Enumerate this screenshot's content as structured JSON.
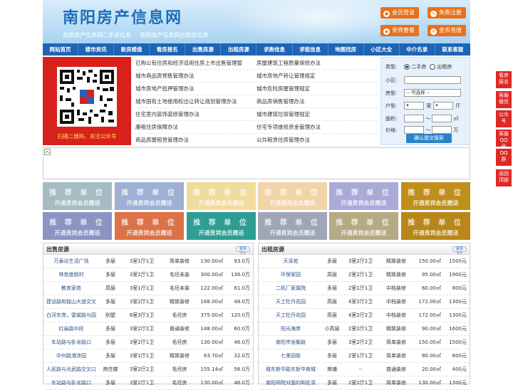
{
  "header": {
    "title": "南阳房产信息网",
    "subtitles": [
      "南阳房产信息网二手房信息",
      "南阳房产信息网出租房信息"
    ],
    "buttons": [
      {
        "label": "会员登录",
        "icon": "user-icon"
      },
      {
        "label": "免费注册",
        "icon": "edit-icon"
      },
      {
        "label": "贵宾套餐",
        "icon": "gift-icon"
      },
      {
        "label": "金币充值",
        "icon": "coin-icon"
      }
    ]
  },
  "nav": [
    "网站首页",
    "楼市资讯",
    "新房楼盘",
    "看房报名",
    "出售房源",
    "出租房源",
    "求购信息",
    "求租信息",
    "地图找房",
    "小区大全",
    "中介名录",
    "联系客服"
  ],
  "qr": {
    "caption": "扫描二维码，关注公众号"
  },
  "links": [
    [
      "已购公有住房和经济适用住房上市出售管理暂",
      "房屋建筑工程质量保修办法"
    ],
    [
      "城市商品房预售管理办法",
      "城市房地产转让管理规定"
    ],
    [
      "城市房地产抵押管理办法",
      "城市危险房屋管理规定"
    ],
    [
      "城市国有土地使用权出让转让规划管理办法",
      "商品房销售管理办法"
    ],
    [
      "住宅室内装饰装修管理办法",
      "城市建筑垃圾管理规定"
    ],
    [
      "廉租住房保障办法",
      "住宅专项维修资金管理办法"
    ],
    [
      "商品房屋租赁管理办法",
      "公共租赁住房管理办法"
    ]
  ],
  "search": {
    "type_label": "类型:",
    "opt_sale": "二手房",
    "opt_rent": "出租房",
    "community_label": "小区:",
    "house_label": "房型:",
    "house_select": "-- 可选择 --",
    "layout_label": "户型:",
    "room": "室",
    "hall": "厅",
    "area_label": "面积:",
    "area_unit": "㎡",
    "tilde": "～",
    "price_label": "价格:",
    "price_unit": "万",
    "submit": "确认提交搜索"
  },
  "tiles": {
    "t1": "推 荐 单 位",
    "t2": "开通贵宾会员赠送",
    "colors": [
      "#a7bcc2",
      "#9fb0d6",
      "#f0dc9e",
      "#f3d3a8",
      "#a9aad8",
      "#bf8f1c",
      "#8c94c4",
      "#dc7248",
      "#2f9e92",
      "#9fa7b7",
      "#b4ab84",
      "#b8861a"
    ]
  },
  "sale": {
    "title": "出售房源",
    "more": "更多>>",
    "rows": [
      [
        "万泰达生活广场",
        "多层",
        "3室1厅1卫",
        "简单装修",
        "130.00㎡",
        "93.0万"
      ],
      [
        "林苑度假村",
        "多层",
        "3室2厅1卫",
        "毛坯未装",
        "300.00㎡",
        "136.0万"
      ],
      [
        "教育家苑",
        "高层",
        "3室1厅1卫",
        "毛坯未装",
        "122.00㎡",
        "61.0万"
      ],
      [
        "建设路和独山大道交叉",
        "多层",
        "3室2厅1卫",
        "精致装修",
        "168.00㎡",
        "48.0万"
      ],
      [
        "白河东岸，雷裳路与园",
        "别墅",
        "6室3厅3卫",
        "毛坯房",
        "375.00㎡",
        "120.0万"
      ],
      [
        "红庙路中段",
        "多层",
        "3室2厅2卫",
        "普通装修",
        "148.00㎡",
        "60.0万"
      ],
      [
        "车站路与卧龙路口",
        "多层",
        "3室2厅1卫",
        "毛坯房",
        "130.00㎡",
        "46.0万"
      ],
      [
        "中州路港凉园",
        "多层",
        "3室1厅1卫",
        "精致装修",
        "63.70㎡",
        "32.0万"
      ],
      [
        "人民路与光武路交叉口",
        "商住楼",
        "3室2厅2卫",
        "毛坯房",
        "155.14㎡",
        "56.0万"
      ],
      [
        "车站路与卧龙路口",
        "多层",
        "3室2厅1卫",
        "毛坯房",
        "130.00㎡",
        "46.0万"
      ]
    ]
  },
  "rent": {
    "title": "出租房源",
    "more": "更多>>",
    "rows": [
      [
        "天泽苑",
        "多层",
        "3室2厅2卫",
        "精致装修",
        "150.00㎡",
        "1500元"
      ],
      [
        "环保家园",
        "高层",
        "2室2厅1卫",
        "精致装修",
        "95.00㎡",
        "1900元"
      ],
      [
        "二机厂家属院",
        "多层",
        "2室1厅1卫",
        "中档装修",
        "60.00㎡",
        "800元"
      ],
      [
        "天工牡丹花园",
        "高层",
        "4室2厅2卫",
        "中档装修",
        "172.00㎡",
        "1300元"
      ],
      [
        "天工牡丹花园",
        "高层",
        "4室2厅2卫",
        "中档装修",
        "172.00㎡",
        "1300元"
      ],
      [
        "阳光海岸",
        "小高层",
        "2室2厅1卫",
        "精致装修",
        "90.00㎡",
        "1600元"
      ],
      [
        "南阳市张衡路",
        "多层",
        "3室2厅2卫",
        "简单装修",
        "150.00㎡",
        "1500元"
      ],
      [
        "七里园街",
        "多层",
        "2室1厅1卫",
        "简单装修",
        "80.00㎡",
        "600元"
      ],
      [
        "城东新华路东新华商城",
        "商铺",
        "--",
        "普通装修",
        "20.00㎡",
        "400元"
      ],
      [
        "南阳师院对面的明伦清",
        "多层",
        "2室2厅1卫",
        "简单装修",
        "130.00㎡",
        "1300元"
      ]
    ]
  },
  "side": [
    "看房报名",
    "客服微信",
    "公众号",
    "客服QQ号",
    "QQ群",
    "返回顶部"
  ]
}
